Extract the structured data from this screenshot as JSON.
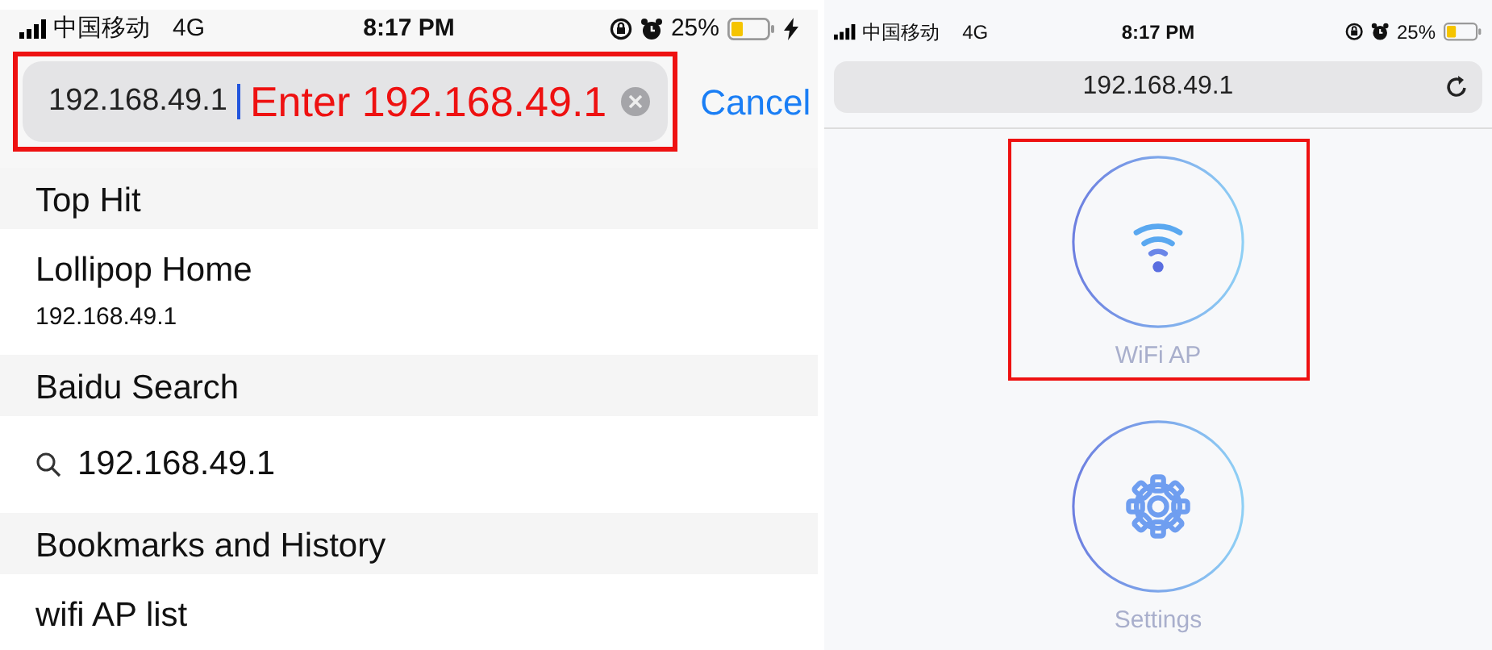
{
  "left_screen": {
    "status_bar": {
      "carrier": "中国移动",
      "network": "4G",
      "time": "8:17 PM",
      "battery": "25%",
      "charging": true
    },
    "search": {
      "value": "192.168.49.1",
      "annotation": "Enter 192.168.49.1",
      "highlighted": true,
      "cancel": "Cancel"
    },
    "sections": [
      {
        "title": "Top Hit",
        "items": [
          {
            "kind": "page",
            "title": "Lollipop Home",
            "subtitle": "192.168.49.1"
          }
        ]
      },
      {
        "title": "Baidu Search",
        "items": [
          {
            "kind": "search",
            "title": "192.168.49.1"
          }
        ]
      },
      {
        "title": "Bookmarks and History",
        "items": [
          {
            "kind": "page",
            "title": "wifi AP list"
          }
        ]
      }
    ]
  },
  "right_screen": {
    "status_bar": {
      "carrier": "中国移动",
      "network": "4G",
      "time": "8:17 PM",
      "battery": "25%"
    },
    "address": "192.168.49.1",
    "tiles": [
      {
        "kind": "wifi",
        "label": "WiFi AP",
        "highlighted": true
      },
      {
        "kind": "settings",
        "label": "Settings",
        "highlighted": false
      }
    ]
  }
}
